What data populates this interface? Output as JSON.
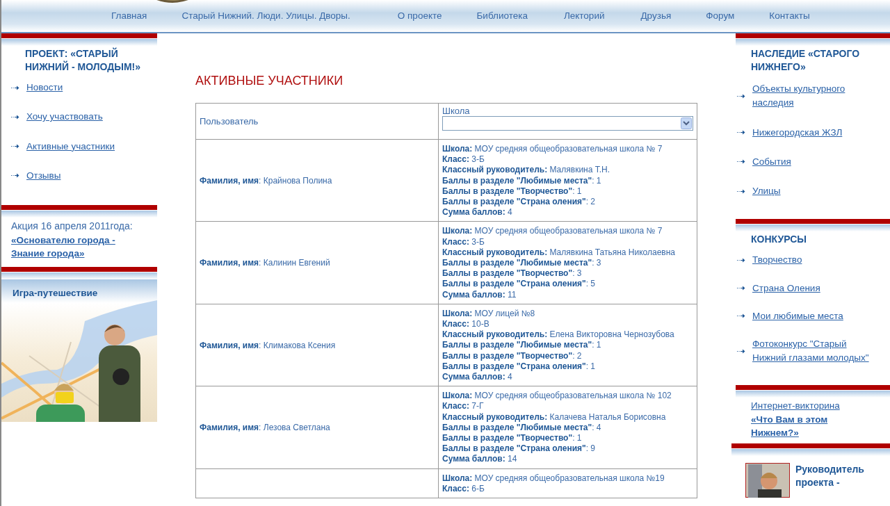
{
  "nav": [
    {
      "label": "Главная"
    },
    {
      "label": "Старый Нижний. Люди. Улицы. Дворы."
    },
    {
      "label": "О проекте"
    },
    {
      "label": "Библиотека"
    },
    {
      "label": "Лекторий"
    },
    {
      "label": "Друзья"
    },
    {
      "label": "Форум"
    },
    {
      "label": "Контакты"
    }
  ],
  "left_sidebar": {
    "project": {
      "title": "ПРОЕКТ: «СТАРЫЙ НИЖНИЙ - МОЛОДЫМ!»",
      "links": [
        "Новости",
        "Хочу участвовать",
        "Активные участники",
        "Отзывы"
      ]
    },
    "promo": {
      "text": "Акция 16 апреля 2011года:",
      "link": "«Основателю города - Знание города»"
    },
    "game": {
      "title": "Игра-путешествие",
      "kind": "picture"
    }
  },
  "main": {
    "title": "АКТИВНЫЕ УЧАСТНИКИ",
    "table": {
      "columns": [
        "Пользователь",
        "Школа"
      ],
      "rows": [
        {
          "name": "**Фамилия, имя**: Крайнова Полина",
          "details": [
            "**Школа:** МОУ средняя общеобразовательная школа № 7",
            "**Класс:** 3-Б",
            "**Классный руководитель:** Малявкина Т.Н.",
            "**Баллы в разделе \"Любимые места\"**: 1",
            "**Баллы в разделе \"Творчество\"**: 1",
            "**Баллы в разделе \"Страна оления\"**: 2",
            "**Сумма баллов:** 4"
          ]
        },
        {
          "name": "**Фамилия, имя**: Калинин Евгений",
          "details": [
            "**Школа:** МОУ средняя общеобразовательная школа № 7",
            "**Класс:** 3-Б",
            "**Классный руководитель:** Малявкина Татьяна Николаевна",
            "**Баллы в разделе \"Любимые места\"**: 3",
            "**Баллы в разделе \"Творчество\"**: 3",
            "**Баллы в разделе \"Страна оления\"**: 5",
            "**Сумма баллов:** 11"
          ]
        },
        {
          "name": "**Фамилия, имя**: Климакова Ксения",
          "details": [
            "**Школа:** МОУ лицей №8",
            "**Класс:** 10-В",
            "**Классный руководитель:** Елена Викторовна Чернозубова",
            "**Баллы в разделе \"Любимые места\"**: 1",
            "**Баллы в разделе \"Творчество\"**: 2",
            "**Баллы в разделе \"Страна оления\"**: 1",
            "**Сумма баллов:** 4"
          ]
        },
        {
          "name": "**Фамилия, имя**: Лезова Светлана",
          "details": [
            "**Школа:** МОУ средняя общеобразовательная школа № 102",
            "**Класс:** 7-Г",
            "**Классный руководитель:** Калачева Наталья Борисовна",
            "**Баллы в разделе \"Любимые места\"**: 4",
            "**Баллы в разделе \"Творчество\"**: 1",
            "**Баллы в разделе \"Страна оления\"**: 9",
            "**Сумма баллов:** 14"
          ]
        },
        {
          "details": [
            "**Школа:** МОУ средняя общеобразовательная школа №19",
            "**Класс:** 6-Б"
          ]
        }
      ]
    }
  },
  "right_sidebar": {
    "heritage": {
      "title": "НАСЛЕДИЕ «СТАРОГО НИЖНЕГО»",
      "links": [
        "Объекты культурного наследия",
        "Нижегородская ЖЗЛ",
        "События",
        "Улицы"
      ]
    },
    "contests": {
      "title": "КОНКУРСЫ",
      "links": [
        "Творчество",
        "Страна Оления",
        "Мои любимые места",
        "Фотоконкурс \"Старый Нижний глазами молодых\""
      ]
    },
    "quiz": {
      "text": "Интернет-викторина",
      "link": "«Что Вам в этом Нижнем?»"
    },
    "leader": {
      "title": "Руководитель проекта -"
    }
  }
}
